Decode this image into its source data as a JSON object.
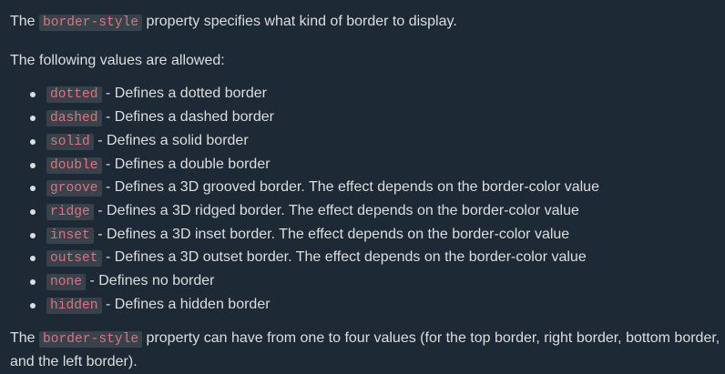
{
  "intro": {
    "before": "The ",
    "code": "border-style",
    "after": " property specifies what kind of border to display."
  },
  "allowed": "The following values are allowed:",
  "values": [
    {
      "code": "dotted",
      "desc": " - Defines a dotted border"
    },
    {
      "code": "dashed",
      "desc": " - Defines a dashed border"
    },
    {
      "code": "solid",
      "desc": " - Defines a solid border"
    },
    {
      "code": "double",
      "desc": " - Defines a double border"
    },
    {
      "code": "groove",
      "desc": " - Defines a 3D grooved border. The effect depends on the border-color value"
    },
    {
      "code": "ridge",
      "desc": " - Defines a 3D ridged border. The effect depends on the border-color value"
    },
    {
      "code": "inset",
      "desc": " - Defines a 3D inset border. The effect depends on the border-color value"
    },
    {
      "code": "outset",
      "desc": " - Defines a 3D outset border. The effect depends on the border-color value"
    },
    {
      "code": "none",
      "desc": " - Defines no border"
    },
    {
      "code": "hidden",
      "desc": " - Defines a hidden border"
    }
  ],
  "outro": {
    "before": "The ",
    "code": "border-style",
    "after": " property can have from one to four values (for the top border, right border, bottom border, and the left border)."
  },
  "colors": {
    "background": "#1d2a35",
    "text": "#dddddd",
    "code_text": "#e2707e",
    "code_background": "#37424b"
  }
}
